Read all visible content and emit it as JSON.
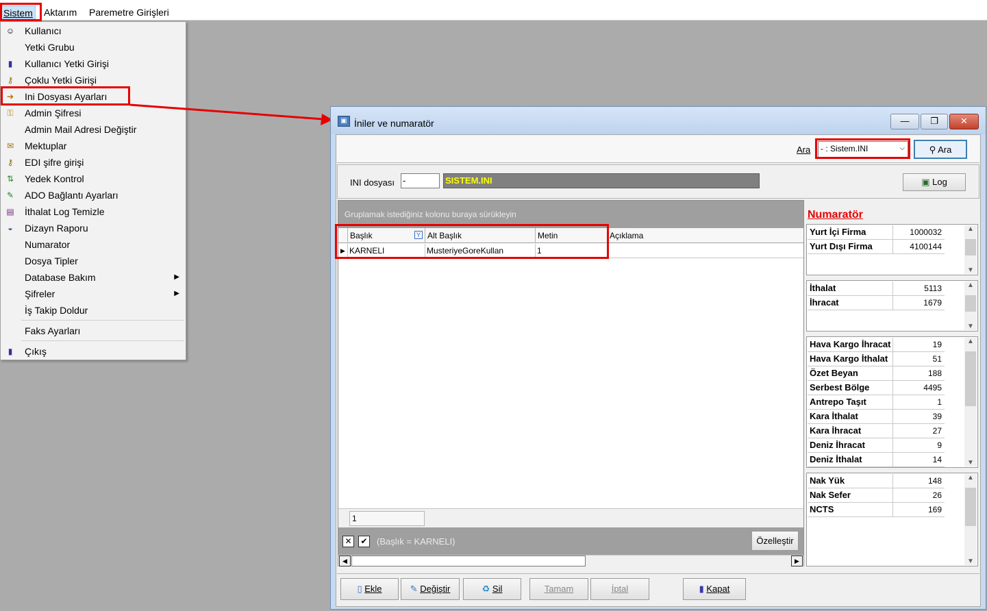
{
  "menubar": {
    "items": [
      {
        "label": "Sistem"
      },
      {
        "label": "Aktarım"
      },
      {
        "label": "Paremetre Girişleri"
      }
    ]
  },
  "dropdown": {
    "items": [
      {
        "label": "Kullanıcı",
        "icon": "user-icon"
      },
      {
        "label": "Yetki Grubu",
        "icon": ""
      },
      {
        "label": "Kullanıcı Yetki Girişi",
        "icon": "person-icon"
      },
      {
        "label": "Çoklu Yetki Girişi",
        "icon": "keys-icon"
      },
      {
        "label": "Ini Dosyası  Ayarları",
        "icon": "ini-file-icon"
      },
      {
        "label": "Admin Şifresi",
        "icon": "key-icon"
      },
      {
        "label": "Admin Mail Adresi Değiştir",
        "icon": ""
      },
      {
        "label": "Mektuplar",
        "icon": "letter-icon"
      },
      {
        "label": "EDI şifre girişi",
        "icon": "keys-icon"
      },
      {
        "label": "Yedek Kontrol",
        "icon": "backup-icon"
      },
      {
        "label": "ADO Bağlantı Ayarları",
        "icon": "connection-icon"
      },
      {
        "label": "İthalat Log Temizle",
        "icon": "log-clean-icon"
      },
      {
        "label": "Dizayn Raporu",
        "icon": "report-icon"
      },
      {
        "label": "Numarator",
        "icon": ""
      },
      {
        "label": "Dosya Tipler",
        "icon": ""
      },
      {
        "label": "Database Bakım",
        "icon": "",
        "submenu": "▶"
      },
      {
        "label": "Şifreler",
        "icon": "",
        "submenu": "▶"
      },
      {
        "label": "İş Takip Doldur",
        "icon": ""
      },
      {
        "label": "Faks Ayarları",
        "icon": ""
      },
      {
        "label": "Çıkış",
        "icon": "exit-icon"
      }
    ]
  },
  "window": {
    "title": "İniler ve numaratör",
    "controls": {
      "minimize": "—",
      "maximize": "❐",
      "close": "✕"
    }
  },
  "search": {
    "label": "Ara",
    "combo_value": "- : Sistem.INI",
    "button": "Ara"
  },
  "ini": {
    "label": "INI dosyası",
    "code_value": "-",
    "name_value": "SISTEM.INI",
    "log_button": "Log"
  },
  "grid": {
    "group_hint": "Gruplamak istediğiniz kolonu buraya sürükleyin",
    "columns": [
      "Başlık",
      "Alt Başlık",
      "Metin",
      "Açıklama"
    ],
    "rows": [
      {
        "baslik": "KARNELI",
        "alt_baslik": "MusteriyeGoreKullan",
        "metin": "1",
        "aciklama": ""
      }
    ],
    "footer_value": "1",
    "filter_text": "(Başlık = KARNELI)",
    "customize_button": "Özelleştir"
  },
  "numerator": {
    "title": "Numaratör",
    "groups": [
      {
        "rows": [
          {
            "label": "Yurt İçi Firma",
            "value": "1000032"
          },
          {
            "label": "Yurt Dışı Firma",
            "value": "4100144"
          }
        ]
      },
      {
        "rows": [
          {
            "label": "İthalat",
            "value": "5113"
          },
          {
            "label": "İhracat",
            "value": "1679"
          }
        ]
      },
      {
        "rows": [
          {
            "label": "Hava Kargo İhracat",
            "value": "19"
          },
          {
            "label": "Hava Kargo İthalat",
            "value": "51"
          },
          {
            "label": "Özet Beyan",
            "value": "188"
          },
          {
            "label": "Serbest Bölge",
            "value": "4495"
          },
          {
            "label": "Antrepo Taşıt",
            "value": "1"
          },
          {
            "label": "Kara İthalat",
            "value": "39"
          },
          {
            "label": "Kara İhracat",
            "value": "27"
          },
          {
            "label": "Deniz İhracat",
            "value": "9"
          },
          {
            "label": "Deniz İthalat",
            "value": "14"
          }
        ]
      },
      {
        "rows": [
          {
            "label": "Nak Yük",
            "value": "148"
          },
          {
            "label": "Nak Sefer",
            "value": "26"
          },
          {
            "label": "NCTS",
            "value": "169"
          }
        ]
      }
    ]
  },
  "bottom_buttons": {
    "ekle": "Ekle",
    "degistir": "Değiştir",
    "sil": "Sil",
    "tamam": "Tamam",
    "iptal": "İptal",
    "kapat": "Kapat"
  },
  "colors": {
    "highlight": "#e60000",
    "ini_name_text": "#ffff00",
    "ini_name_bg": "#808080",
    "numerator_title": "#e60000"
  }
}
